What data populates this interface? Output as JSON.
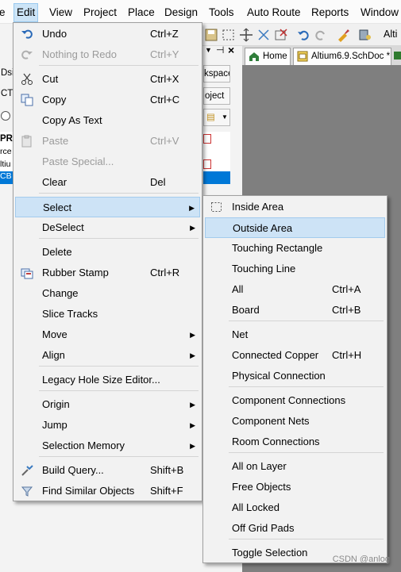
{
  "menubar": {
    "items": [
      "e",
      "Edit",
      "View",
      "Project",
      "Place",
      "Design",
      "Tools",
      "Auto Route",
      "Reports",
      "Window"
    ]
  },
  "toolbar": {
    "right_text": "Alti"
  },
  "tabs": {
    "home": "Home",
    "doc": "Altium6.9.SchDoc *"
  },
  "side": {
    "workspace_btn": "kspace",
    "project_btn": "oject",
    "rows": [
      "Dsi",
      "CT",
      "PR",
      "rce",
      "ltiu",
      "CB"
    ]
  },
  "edit_menu": {
    "items": [
      {
        "label": "Undo",
        "shortcut": "Ctrl+Z",
        "icon": "undo-icon",
        "disabled": false
      },
      {
        "label": "Nothing to Redo",
        "shortcut": "Ctrl+Y",
        "icon": "redo-icon",
        "disabled": true
      },
      {
        "label": "Cut",
        "shortcut": "Ctrl+X",
        "icon": "scissors-icon",
        "disabled": false
      },
      {
        "label": "Copy",
        "shortcut": "Ctrl+C",
        "icon": "copy-icon",
        "disabled": false
      },
      {
        "label": "Copy As Text",
        "shortcut": "",
        "icon": "",
        "disabled": false
      },
      {
        "label": "Paste",
        "shortcut": "Ctrl+V",
        "icon": "paste-icon",
        "disabled": true
      },
      {
        "label": "Paste Special...",
        "shortcut": "",
        "icon": "",
        "disabled": true
      },
      {
        "label": "Clear",
        "shortcut": "Del",
        "icon": "",
        "disabled": false
      },
      {
        "label": "Select",
        "shortcut": "",
        "icon": "",
        "submenu": true,
        "highlighted": true
      },
      {
        "label": "DeSelect",
        "shortcut": "",
        "icon": "",
        "submenu": true
      },
      {
        "label": "Delete",
        "shortcut": "",
        "icon": "",
        "disabled": false
      },
      {
        "label": "Rubber Stamp",
        "shortcut": "Ctrl+R",
        "icon": "stamp-icon",
        "disabled": false
      },
      {
        "label": "Change",
        "shortcut": "",
        "icon": "",
        "disabled": false
      },
      {
        "label": "Slice Tracks",
        "shortcut": "",
        "icon": "",
        "disabled": false
      },
      {
        "label": "Move",
        "shortcut": "",
        "icon": "",
        "submenu": true
      },
      {
        "label": "Align",
        "shortcut": "",
        "icon": "",
        "submenu": true
      },
      {
        "label": "Legacy Hole Size Editor...",
        "shortcut": "",
        "icon": "",
        "disabled": false
      },
      {
        "label": "Origin",
        "shortcut": "",
        "icon": "",
        "submenu": true
      },
      {
        "label": "Jump",
        "shortcut": "",
        "icon": "",
        "submenu": true
      },
      {
        "label": "Selection Memory",
        "shortcut": "",
        "icon": "",
        "submenu": true
      },
      {
        "label": "Build Query...",
        "shortcut": "Shift+B",
        "icon": "query-icon",
        "disabled": false
      },
      {
        "label": "Find Similar Objects",
        "shortcut": "Shift+F",
        "icon": "filter-icon",
        "disabled": false
      }
    ]
  },
  "select_menu": {
    "items": [
      {
        "label": "Inside Area",
        "shortcut": "",
        "icon": "dotted-rect-icon"
      },
      {
        "label": "Outside Area",
        "shortcut": "",
        "highlighted": true
      },
      {
        "label": "Touching Rectangle",
        "shortcut": ""
      },
      {
        "label": "Touching Line",
        "shortcut": ""
      },
      {
        "label": "All",
        "shortcut": "Ctrl+A"
      },
      {
        "label": "Board",
        "shortcut": "Ctrl+B"
      },
      {
        "label": "Net",
        "shortcut": ""
      },
      {
        "label": "Connected Copper",
        "shortcut": "Ctrl+H"
      },
      {
        "label": "Physical Connection",
        "shortcut": ""
      },
      {
        "label": "Component Connections",
        "shortcut": ""
      },
      {
        "label": "Component Nets",
        "shortcut": ""
      },
      {
        "label": "Room Connections",
        "shortcut": ""
      },
      {
        "label": "All on Layer",
        "shortcut": ""
      },
      {
        "label": "Free Objects",
        "shortcut": ""
      },
      {
        "label": "All Locked",
        "shortcut": ""
      },
      {
        "label": "Off Grid Pads",
        "shortcut": ""
      },
      {
        "label": "Toggle Selection",
        "shortcut": ""
      }
    ]
  },
  "watermark": "CSDN @anlog",
  "colors": {
    "highlight": "#cde3f6",
    "menu_bg": "#f2f2f2",
    "dark_area": "#7f7f7f"
  }
}
